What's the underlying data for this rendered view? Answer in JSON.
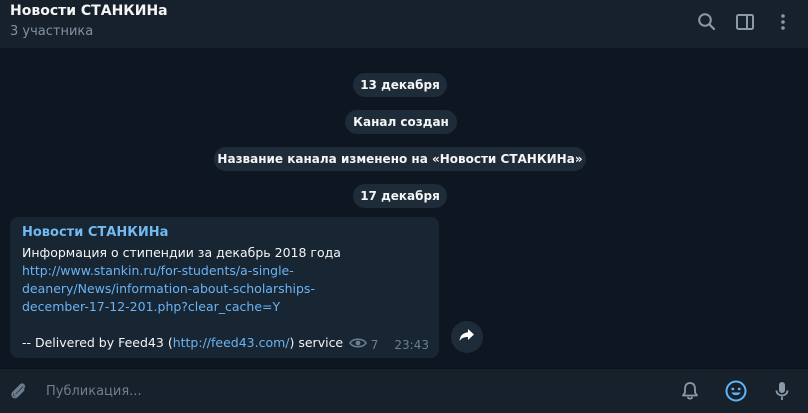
{
  "header": {
    "title": "Новости СТАНКИНа",
    "subtitle": "3 участника",
    "icons": [
      "search-icon",
      "sidebar-toggle-icon",
      "more-vertical-icon"
    ]
  },
  "service_messages": {
    "date1": "13 декабря",
    "created": "Канал создан",
    "renamed": "Название канала изменено на «Новости СТАНКИНа»",
    "date2": "17 декабря"
  },
  "message": {
    "author": "Новости СТАНКИНа",
    "text": "Информация о стипендии за декабрь 2018 года",
    "link_line1": "http://www.stankin.ru/for-students/a-single-",
    "link_line2": "deanery/News/information-about-scholarships-",
    "link_line3": "december-17-12-201.php?clear_cache=Y",
    "footer_prefix": "-- Delivered by Feed43 (",
    "footer_link": "http://feed43.com/",
    "footer_suffix": ") service",
    "views": "7",
    "time": "23:43"
  },
  "composer": {
    "placeholder": "Публикация...",
    "icons": [
      "paperclip-icon",
      "bell-icon",
      "emoji-icon",
      "microphone-icon"
    ]
  },
  "colors": {
    "background": "#0e1621",
    "panel": "#17212b",
    "bubble": "#182533",
    "accent": "#6ab3f3",
    "author": "#71baf2",
    "muted": "#6d7f8f"
  }
}
